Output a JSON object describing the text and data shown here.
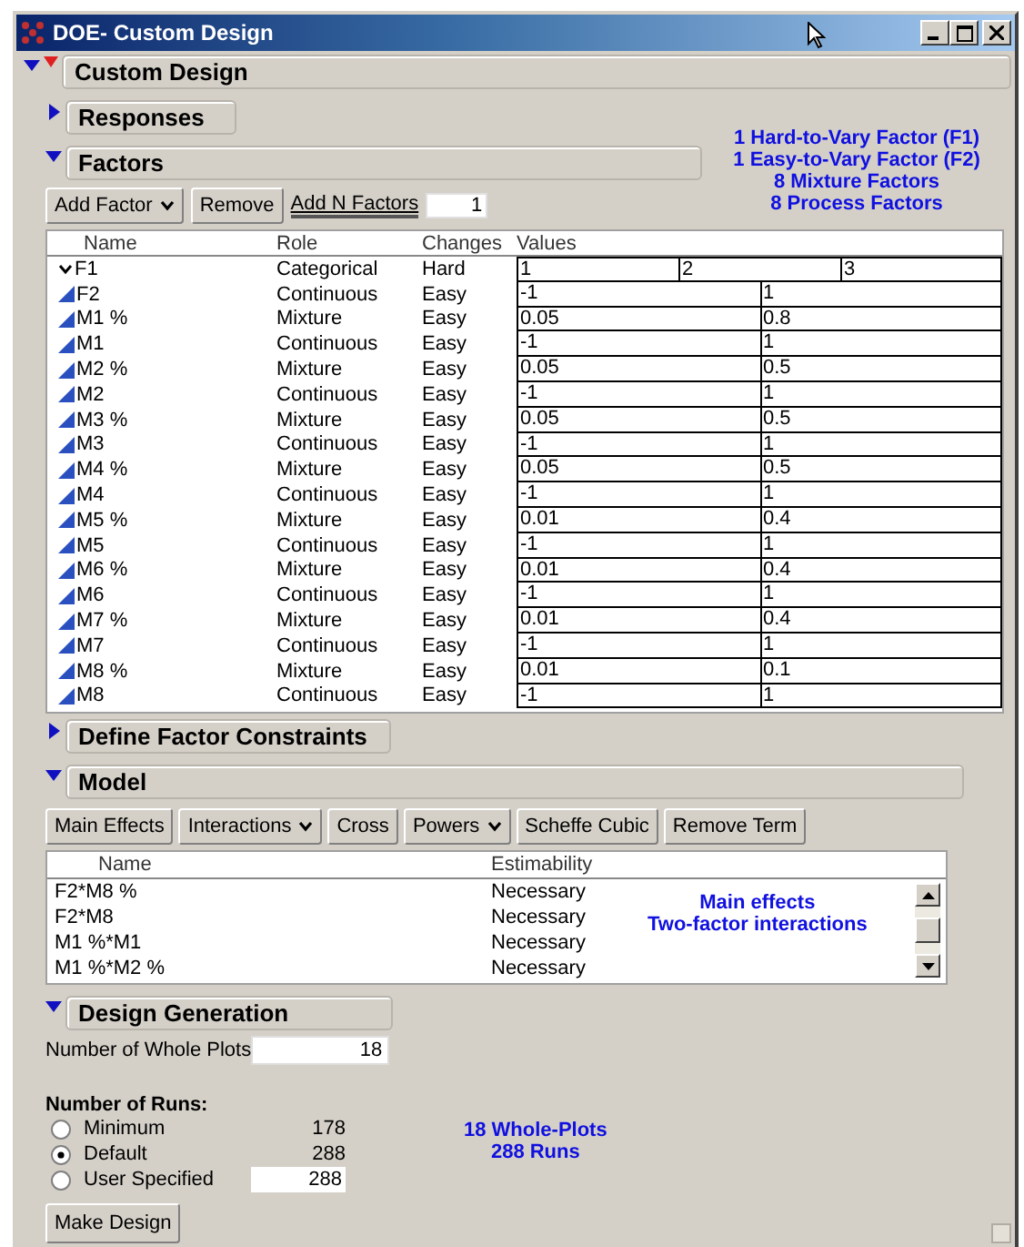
{
  "window": {
    "title": "DOE- Custom Design"
  },
  "custom_design": {
    "title": "Custom Design",
    "expanded": true
  },
  "responses": {
    "title": "Responses",
    "expanded": false
  },
  "factors": {
    "title": "Factors",
    "expanded": true,
    "summary": [
      "1 Hard-to-Vary Factor (F1)",
      "1 Easy-to-Vary Factor (F2)",
      "8 Mixture Factors",
      "8 Process Factors"
    ],
    "toolbar": {
      "add_factor": "Add Factor",
      "remove": "Remove",
      "add_n_label": "Add N Factors",
      "add_n_value": "1"
    },
    "columns": [
      "Name",
      "Role",
      "Changes",
      "Values"
    ],
    "rows": [
      {
        "kind": "categorical",
        "name": "F1",
        "role": "Categorical",
        "changes": "Hard",
        "values": [
          "1",
          "2",
          "3"
        ]
      },
      {
        "kind": "continuous",
        "name": "F2",
        "role": "Continuous",
        "changes": "Easy",
        "values": [
          "-1",
          "1"
        ]
      },
      {
        "kind": "continuous",
        "name": "M1 %",
        "role": "Mixture",
        "changes": "Easy",
        "values": [
          "0.05",
          "0.8"
        ]
      },
      {
        "kind": "continuous",
        "name": "M1",
        "role": "Continuous",
        "changes": "Easy",
        "values": [
          "-1",
          "1"
        ]
      },
      {
        "kind": "continuous",
        "name": "M2 %",
        "role": "Mixture",
        "changes": "Easy",
        "values": [
          "0.05",
          "0.5"
        ]
      },
      {
        "kind": "continuous",
        "name": "M2",
        "role": "Continuous",
        "changes": "Easy",
        "values": [
          "-1",
          "1"
        ]
      },
      {
        "kind": "continuous",
        "name": "M3 %",
        "role": "Mixture",
        "changes": "Easy",
        "values": [
          "0.05",
          "0.5"
        ]
      },
      {
        "kind": "continuous",
        "name": "M3",
        "role": "Continuous",
        "changes": "Easy",
        "values": [
          "-1",
          "1"
        ]
      },
      {
        "kind": "continuous",
        "name": "M4 %",
        "role": "Mixture",
        "changes": "Easy",
        "values": [
          "0.05",
          "0.5"
        ]
      },
      {
        "kind": "continuous",
        "name": "M4",
        "role": "Continuous",
        "changes": "Easy",
        "values": [
          "-1",
          "1"
        ]
      },
      {
        "kind": "continuous",
        "name": "M5 %",
        "role": "Mixture",
        "changes": "Easy",
        "values": [
          "0.01",
          "0.4"
        ]
      },
      {
        "kind": "continuous",
        "name": "M5",
        "role": "Continuous",
        "changes": "Easy",
        "values": [
          "-1",
          "1"
        ]
      },
      {
        "kind": "continuous",
        "name": "M6 %",
        "role": "Mixture",
        "changes": "Easy",
        "values": [
          "0.01",
          "0.4"
        ]
      },
      {
        "kind": "continuous",
        "name": "M6",
        "role": "Continuous",
        "changes": "Easy",
        "values": [
          "-1",
          "1"
        ]
      },
      {
        "kind": "continuous",
        "name": "M7 %",
        "role": "Mixture",
        "changes": "Easy",
        "values": [
          "0.01",
          "0.4"
        ]
      },
      {
        "kind": "continuous",
        "name": "M7",
        "role": "Continuous",
        "changes": "Easy",
        "values": [
          "-1",
          "1"
        ]
      },
      {
        "kind": "continuous",
        "name": "M8 %",
        "role": "Mixture",
        "changes": "Easy",
        "values": [
          "0.01",
          "0.1"
        ]
      },
      {
        "kind": "continuous",
        "name": "M8",
        "role": "Continuous",
        "changes": "Easy",
        "values": [
          "-1",
          "1"
        ]
      }
    ]
  },
  "constraints": {
    "title": "Define Factor Constraints",
    "expanded": false
  },
  "model": {
    "title": "Model",
    "expanded": true,
    "buttons": [
      {
        "label": "Main Effects",
        "kind": "button"
      },
      {
        "label": "Interactions",
        "kind": "dropdown"
      },
      {
        "label": "Cross",
        "kind": "button"
      },
      {
        "label": "Powers",
        "kind": "dropdown"
      },
      {
        "label": "Scheffe Cubic",
        "kind": "button"
      },
      {
        "label": "Remove Term",
        "kind": "button"
      }
    ],
    "columns": [
      "Name",
      "Estimability"
    ],
    "terms": [
      {
        "name": "F2*M8 %",
        "estimability": "Necessary"
      },
      {
        "name": "F2*M8",
        "estimability": "Necessary"
      },
      {
        "name": "M1 %*M1",
        "estimability": "Necessary"
      },
      {
        "name": "M1 %*M2 %",
        "estimability": "Necessary"
      }
    ],
    "summary": [
      "Main effects",
      "Two-factor interactions"
    ]
  },
  "design_generation": {
    "title": "Design Generation",
    "expanded": true,
    "whole_plots_label": "Number of Whole Plots",
    "whole_plots_value": "18",
    "runs_label": "Number of Runs:",
    "runs": [
      {
        "kind": "text",
        "label": "Minimum",
        "value": "178",
        "selected": false
      },
      {
        "kind": "text",
        "label": "Default",
        "value": "288",
        "selected": true
      },
      {
        "kind": "field",
        "label": "User Specified",
        "value": "288",
        "selected": false
      }
    ],
    "summary": [
      "18 Whole-Plots",
      "288 Runs"
    ],
    "make_design": "Make Design"
  }
}
